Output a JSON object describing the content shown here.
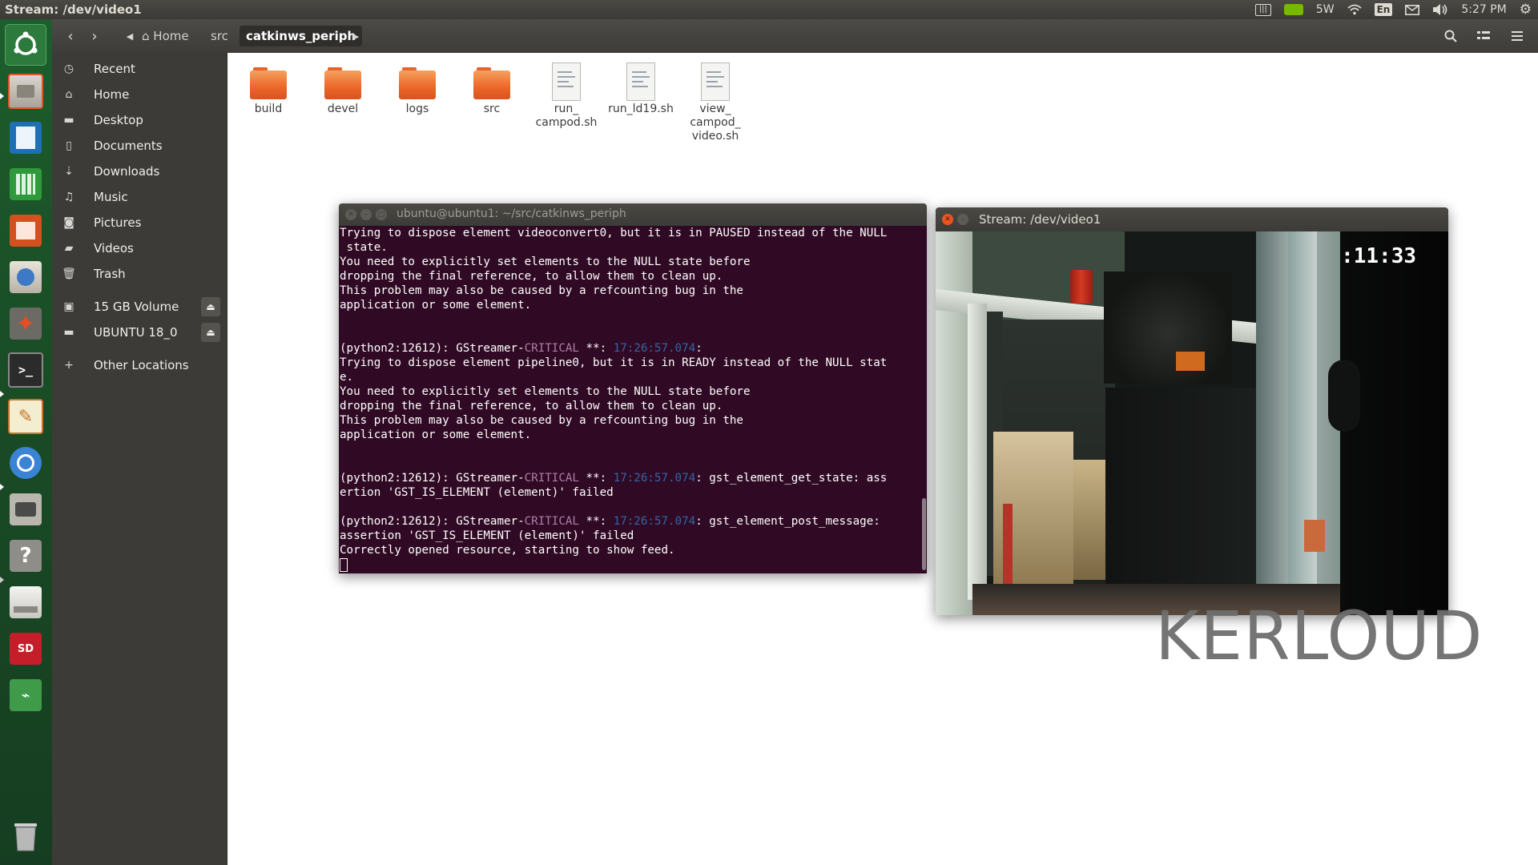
{
  "top_panel": {
    "window_title": "Stream: /dev/video1",
    "power": "5W",
    "keyboard_layout": "En",
    "clock": "5:27 PM"
  },
  "launcher": {
    "items": [
      "dash-home",
      "files",
      "writer",
      "calc",
      "impress",
      "software-center",
      "system-settings",
      "terminal",
      "text-editor",
      "chromium",
      "cheese",
      "help",
      "disk",
      "sd-card",
      "usb",
      "trash"
    ]
  },
  "file_manager": {
    "breadcrumbs": [
      "Home",
      "src",
      "catkinws_periph"
    ],
    "sidebar": [
      {
        "label": "Recent",
        "icon": "clock-icon"
      },
      {
        "label": "Home",
        "icon": "home-icon"
      },
      {
        "label": "Desktop",
        "icon": "folder-icon"
      },
      {
        "label": "Documents",
        "icon": "document-icon"
      },
      {
        "label": "Downloads",
        "icon": "download-icon"
      },
      {
        "label": "Music",
        "icon": "music-icon"
      },
      {
        "label": "Pictures",
        "icon": "camera-icon"
      },
      {
        "label": "Videos",
        "icon": "video-icon"
      },
      {
        "label": "Trash",
        "icon": "trash-icon"
      }
    ],
    "devices": [
      {
        "label": "15 GB Volume"
      },
      {
        "label": "UBUNTU 18_0"
      }
    ],
    "other_locations": "Other Locations",
    "files": [
      {
        "name": "build",
        "type": "folder"
      },
      {
        "name": "devel",
        "type": "folder"
      },
      {
        "name": "logs",
        "type": "folder"
      },
      {
        "name": "src",
        "type": "folder"
      },
      {
        "name_lines": [
          "run_",
          "campod.sh"
        ],
        "type": "file"
      },
      {
        "name_lines": [
          "run_ld19.sh"
        ],
        "type": "file"
      },
      {
        "name_lines": [
          "view_",
          "campod_",
          "video.sh"
        ],
        "type": "file"
      }
    ]
  },
  "terminal": {
    "title": "ubuntu@ubuntu1: ~/src/catkinws_periph",
    "lines": [
      [
        {
          "t": "Trying to dispose element videoconvert0, but it is in PAUSED instead of the NULL"
        }
      ],
      [
        {
          "t": " state."
        }
      ],
      [
        {
          "t": "You need to explicitly set elements to the NULL state before"
        }
      ],
      [
        {
          "t": "dropping the final reference, to allow them to clean up."
        }
      ],
      [
        {
          "t": "This problem may also be caused by a refcounting bug in the"
        }
      ],
      [
        {
          "t": "application or some element."
        }
      ],
      [
        {
          "t": ""
        }
      ],
      [
        {
          "t": ""
        }
      ],
      [
        {
          "t": "(python2:12612): GStreamer-"
        },
        {
          "t": "CRITICAL",
          "c": "crit"
        },
        {
          "t": " **: "
        },
        {
          "t": "17:26:57.074",
          "c": "ts"
        },
        {
          "t": ":"
        }
      ],
      [
        {
          "t": "Trying to dispose element pipeline0, but it is in READY instead of the NULL stat"
        }
      ],
      [
        {
          "t": "e."
        }
      ],
      [
        {
          "t": "You need to explicitly set elements to the NULL state before"
        }
      ],
      [
        {
          "t": "dropping the final reference, to allow them to clean up."
        }
      ],
      [
        {
          "t": "This problem may also be caused by a refcounting bug in the"
        }
      ],
      [
        {
          "t": "application or some element."
        }
      ],
      [
        {
          "t": ""
        }
      ],
      [
        {
          "t": ""
        }
      ],
      [
        {
          "t": "(python2:12612): GStreamer-"
        },
        {
          "t": "CRITICAL",
          "c": "crit"
        },
        {
          "t": " **: "
        },
        {
          "t": "17:26:57.074",
          "c": "ts"
        },
        {
          "t": ": gst_element_get_state: ass"
        }
      ],
      [
        {
          "t": "ertion 'GST_IS_ELEMENT (element)' failed"
        }
      ],
      [
        {
          "t": ""
        }
      ],
      [
        {
          "t": "(python2:12612): GStreamer-"
        },
        {
          "t": "CRITICAL",
          "c": "crit"
        },
        {
          "t": " **: "
        },
        {
          "t": "17:26:57.074",
          "c": "ts"
        },
        {
          "t": ": gst_element_post_message:"
        }
      ],
      [
        {
          "t": "assertion 'GST_IS_ELEMENT (element)' failed"
        }
      ],
      [
        {
          "t": "Correctly opened resource, starting to show feed."
        }
      ]
    ]
  },
  "stream_window": {
    "title": "Stream: /dev/video1",
    "overlay_time": ":11:33"
  },
  "watermark": "KERLOUD",
  "colors": {
    "terminal_bg": "#300a24",
    "critical": "#ad7fa8",
    "timestamp": "#3465a4",
    "folder_orange": "#ec6a2c",
    "launcher_green": "#1a4d26"
  }
}
